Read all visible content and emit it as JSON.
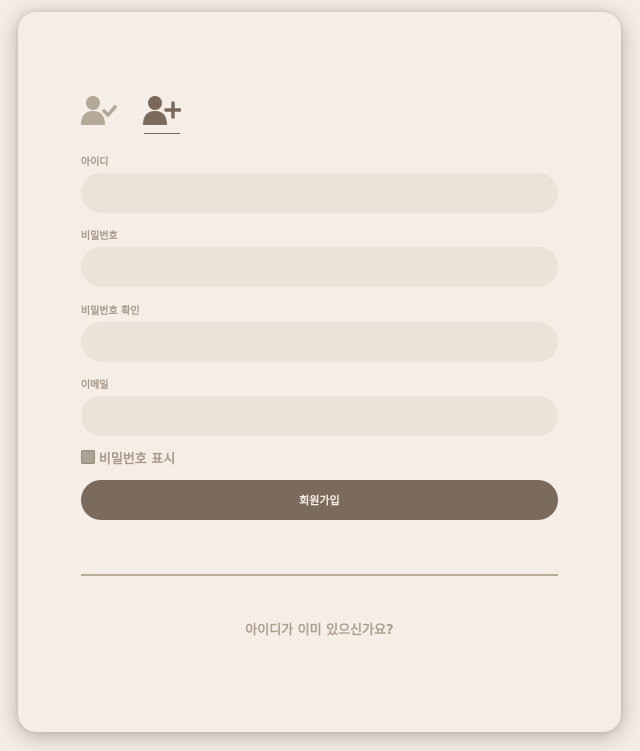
{
  "tabs": {
    "login_icon": "user-check-icon",
    "signup_icon": "user-plus-icon",
    "active": "signup"
  },
  "form": {
    "fields": [
      {
        "label": "아이디",
        "value": "",
        "placeholder": ""
      },
      {
        "label": "비밀번호",
        "value": "",
        "placeholder": ""
      },
      {
        "label": "비밀번호 확인",
        "value": "",
        "placeholder": ""
      },
      {
        "label": "이메일",
        "value": "",
        "placeholder": ""
      }
    ],
    "show_password_label": "비밀번호 표시",
    "submit_label": "회원가입"
  },
  "footer": {
    "login_prompt": "아이디가 이미 있으신가요?"
  },
  "colors": {
    "background": "#f4eee6",
    "input": "#ebe3d8",
    "button": "#7b6b5d",
    "label": "#a8998a",
    "icon_inactive": "#b4a898",
    "icon_active": "#7b6a5c"
  }
}
